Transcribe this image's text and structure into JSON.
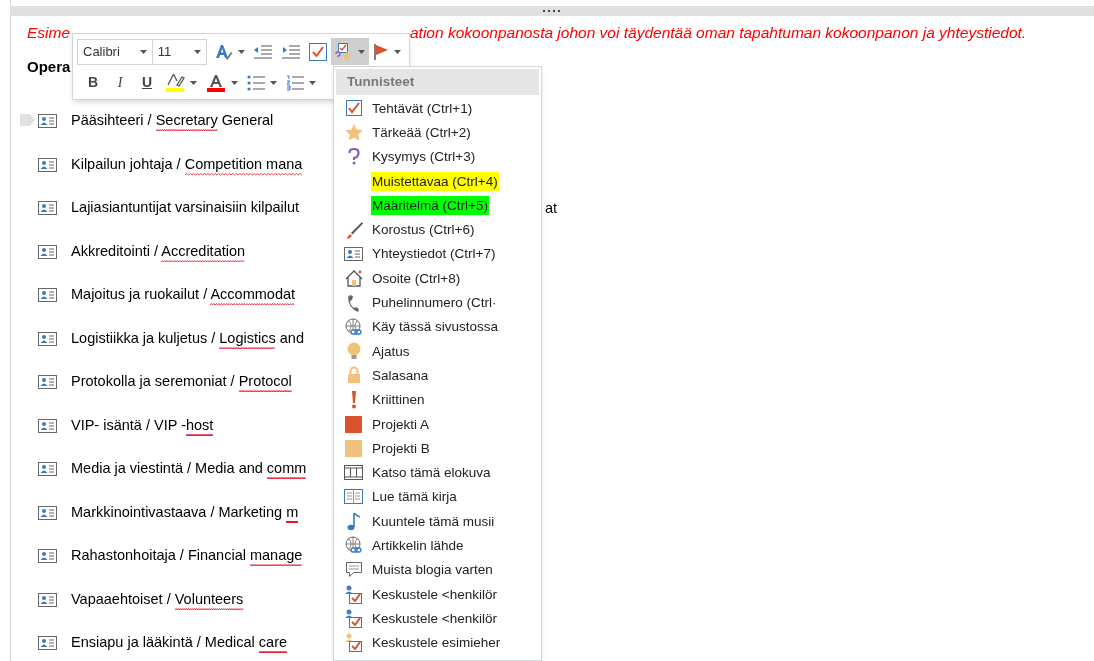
{
  "note": [
    "Esime",
    "ation kokoonpanosta johon voi täydentää oman tapahtuman kokoonpanon ja yhteystiedot."
  ],
  "heading": "Opera",
  "rows": [
    {
      "handle": true,
      "segments": [
        {
          "text": "Pääsihteeri / "
        },
        {
          "text": "Secretary",
          "spell_error": true
        },
        {
          "text": " General"
        }
      ]
    },
    {
      "segments": [
        {
          "text": "Kilpailun johtaja / "
        },
        {
          "text": "Competition mana",
          "spell_error": true
        }
      ]
    },
    {
      "segments": [
        {
          "text": "Lajiasiantuntijat varsinaisiin kilpailut"
        }
      ],
      "tail": "at"
    },
    {
      "segments": [
        {
          "text": "Akkreditointi / "
        },
        {
          "text": "Accreditation",
          "spell_error": true
        }
      ]
    },
    {
      "segments": [
        {
          "text": "Majoitus ja ruokailut / "
        },
        {
          "text": "Accommodat",
          "spell_error": true
        }
      ]
    },
    {
      "segments": [
        {
          "text": "Logistiikka ja kuljetus / "
        },
        {
          "text": "Logistics",
          "spell_error": true
        },
        {
          "text": " and"
        }
      ]
    },
    {
      "segments": [
        {
          "text": "Protokolla ja seremoniat / "
        },
        {
          "text": "Protocol",
          "spell_error": true
        }
      ]
    },
    {
      "segments": [
        {
          "text": "VIP- isäntä / VIP -"
        },
        {
          "text": "host",
          "spell_error": true
        }
      ]
    },
    {
      "segments": [
        {
          "text": "Media ja viestintä / Media and "
        },
        {
          "text": "comm",
          "spell_error": true
        }
      ]
    },
    {
      "segments": [
        {
          "text": "Markkinointivastaava / Marketing "
        },
        {
          "text": "m",
          "spell_error": true
        }
      ]
    },
    {
      "segments": [
        {
          "text": "Rahastonhoitaja / Financial "
        },
        {
          "text": "manage",
          "spell_error": true
        }
      ]
    },
    {
      "segments": [
        {
          "text": "Vapaaehtoiset / "
        },
        {
          "text": "Volunteers",
          "spell_error": true
        }
      ]
    },
    {
      "segments": [
        {
          "text": "Ensiapu ja lääkintä / Medical "
        },
        {
          "text": "care",
          "spell_error": true
        }
      ]
    }
  ],
  "toolbar": {
    "font": "Calibri",
    "size": "11",
    "buttons": [
      {
        "kind": "styles",
        "dropdown": true,
        "selected": false
      },
      {
        "kind": "outdent",
        "dropdown": false,
        "selected": false
      },
      {
        "kind": "indent",
        "dropdown": false,
        "selected": false
      },
      {
        "kind": "todo",
        "dropdown": false,
        "selected": false
      },
      {
        "kind": "tags",
        "dropdown": true,
        "selected": true
      },
      {
        "kind": "flag",
        "dropdown": true,
        "selected": false
      }
    ],
    "format_buttons": [
      {
        "kind": "bold",
        "label": "B",
        "dropdown": false
      },
      {
        "kind": "italic",
        "label": "I",
        "dropdown": false
      },
      {
        "kind": "underline",
        "label": "U",
        "dropdown": false
      },
      {
        "kind": "highlight",
        "dropdown": true
      },
      {
        "kind": "fontcolor",
        "dropdown": true
      },
      {
        "kind": "bullets",
        "dropdown": true
      },
      {
        "kind": "numbering",
        "dropdown": true
      }
    ]
  },
  "tag_menu": {
    "title": "Tunnisteet",
    "items": [
      {
        "kind": "check",
        "label": "Tehtävät (Ctrl+1)"
      },
      {
        "kind": "star",
        "label": "Tärkeää (Ctrl+2)"
      },
      {
        "kind": "question",
        "label": "Kysymys (Ctrl+3)"
      },
      {
        "kind": "none",
        "label": "Muistettavaa (Ctrl+4)",
        "color": "#ffff00"
      },
      {
        "kind": "none",
        "label": "Määritelmä (Ctrl+5)",
        "color": "#00ff00"
      },
      {
        "kind": "brush",
        "label": "Korostus (Ctrl+6)"
      },
      {
        "kind": "contact",
        "label": "Yhteystiedot (Ctrl+7)"
      },
      {
        "kind": "house",
        "label": "Osoite (Ctrl+8)"
      },
      {
        "kind": "phone",
        "label": "Puhelinnumero (Ctrl·"
      },
      {
        "kind": "globe",
        "label": "Käy tässä sivustossa"
      },
      {
        "kind": "bulb",
        "label": "Ajatus"
      },
      {
        "kind": "lock",
        "label": "Salasana"
      },
      {
        "kind": "exclamation",
        "label": "Kriittinen"
      },
      {
        "kind": "square",
        "label": "Projekti A",
        "color": "#d9532c"
      },
      {
        "kind": "square",
        "label": "Projekti B",
        "color": "#f0c27b"
      },
      {
        "kind": "film",
        "label": "Katso tämä elokuva"
      },
      {
        "kind": "book",
        "label": "Lue tämä kirja"
      },
      {
        "kind": "note",
        "label": "Kuuntele tämä musii"
      },
      {
        "kind": "globe",
        "label": "Artikkelin lähde"
      },
      {
        "kind": "speech",
        "label": "Muista blogia varten"
      },
      {
        "kind": "person",
        "label": "Keskustele <henkilör",
        "color": "#4a7fc1"
      },
      {
        "kind": "person",
        "label": "Keskustele <henkilör",
        "color": "#4a7fc1"
      },
      {
        "kind": "person",
        "label": "Keskustele esimieher",
        "color": "#f0c27b"
      }
    ]
  }
}
